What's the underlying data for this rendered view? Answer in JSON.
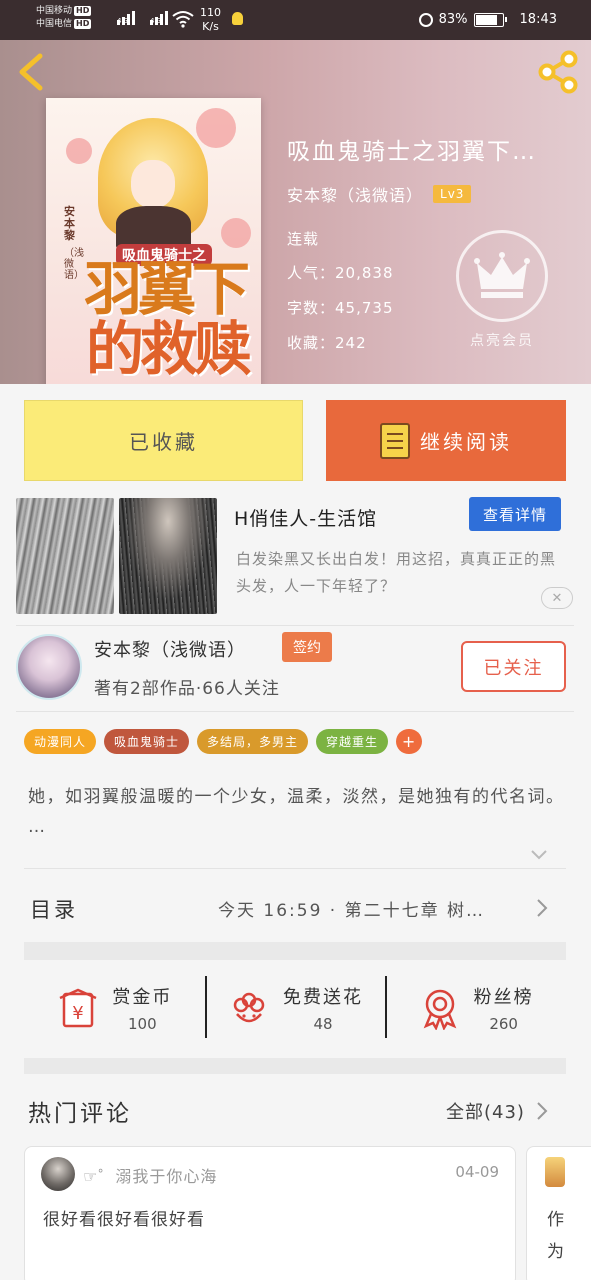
{
  "status_bar": {
    "carrier1": "中国移动",
    "carrier2": "中国电信",
    "hd": "HD",
    "net1": "4G",
    "net2": "4G",
    "speed_value": "110",
    "speed_unit": "K/s",
    "battery": "83%",
    "battery_level": 0.83,
    "time": "18:43"
  },
  "book": {
    "title": "吸血鬼骑士之羽翼下…",
    "author": "安本黎（浅微语）",
    "level": "Lv3",
    "status": "连载",
    "popularity_label": "人气：",
    "popularity": "20,838",
    "words_label": "字数：",
    "words": "45,735",
    "favorites_label": "收藏：",
    "favorites": "242",
    "vip_label": "点亮会员",
    "cover": {
      "subtitle": "吸血鬼骑士之",
      "title_line1": "羽翼下",
      "title_line2": "的救赎",
      "author_vertical": "安本黎",
      "pen_vertical": "（浅微语）"
    }
  },
  "actions": {
    "collected": "已收藏",
    "continue_reading": "继续阅读"
  },
  "ad": {
    "title": "H俏佳人-生活馆",
    "detail_button": "查看详情",
    "description": "白发染黑又长出白发！用这招，真真正正的黑头发，人一下年轻了？",
    "close": "✕"
  },
  "author": {
    "name": "安本黎（浅微语）",
    "badge": "签约",
    "meta": "著有2部作品·66人关注",
    "follow_button": "已关注"
  },
  "tags": [
    {
      "label": "动漫同人",
      "color": "#f5a623"
    },
    {
      "label": "吸血鬼骑士",
      "color": "#c0573d"
    },
    {
      "label": "多结局，多男主",
      "color": "#d99a2b"
    },
    {
      "label": "穿越重生",
      "color": "#7cb342"
    },
    {
      "label": "+",
      "color": "#ef6c3d"
    }
  ],
  "synopsis": "她，如羽翼般温暖的一个少女，温柔，淡然，是她独有的代名词。 …",
  "catalog": {
    "label": "目录",
    "latest": "今天 16:59 · 第二十七章 树…"
  },
  "gifts": [
    {
      "label": "赏金币",
      "value": "100",
      "icon": "coin-envelope-icon"
    },
    {
      "label": "免费送花",
      "value": "48",
      "icon": "flower-icon"
    },
    {
      "label": "粉丝榜",
      "value": "260",
      "icon": "medal-icon"
    }
  ],
  "comments": {
    "title": "热门评论",
    "all": "全部(43)",
    "items": [
      {
        "user": "☞゜溺我于你心海",
        "date": "04-09",
        "text": "很好看很好看很好看"
      },
      {
        "text_line1": "作",
        "text_line2": "为"
      }
    ]
  }
}
